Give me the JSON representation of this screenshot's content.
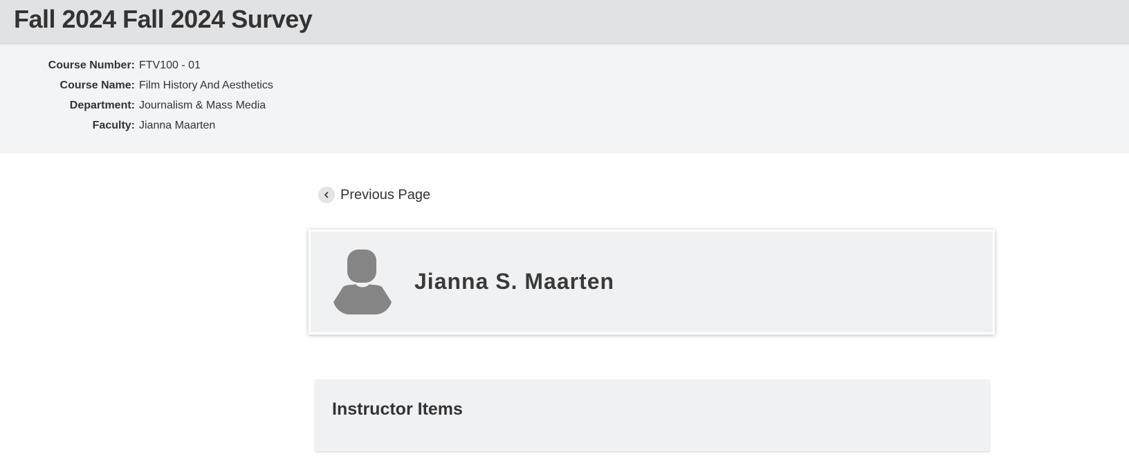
{
  "header": {
    "title": "Fall 2024 Fall 2024 Survey"
  },
  "course_info": {
    "rows": [
      {
        "label": "Course Number:",
        "value": "FTV100 - 01"
      },
      {
        "label": "Course Name:",
        "value": "Film History And Aesthetics"
      },
      {
        "label": "Department:",
        "value": "Journalism & Mass Media"
      },
      {
        "label": "Faculty:",
        "value": "Jianna Maarten"
      }
    ]
  },
  "navigation": {
    "previous_label": "Previous Page",
    "previous_icon": "chevron-left-icon"
  },
  "profile": {
    "name": "Jianna S. Maarten",
    "avatar_icon": "user-silhouette-icon"
  },
  "sections": [
    {
      "title": "Instructor Items"
    }
  ],
  "colors": {
    "header_bg": "#e1e2e4",
    "info_bg": "#f3f4f6",
    "card_bg": "#f0f1f3",
    "avatar": "#858585",
    "text": "#333333"
  }
}
